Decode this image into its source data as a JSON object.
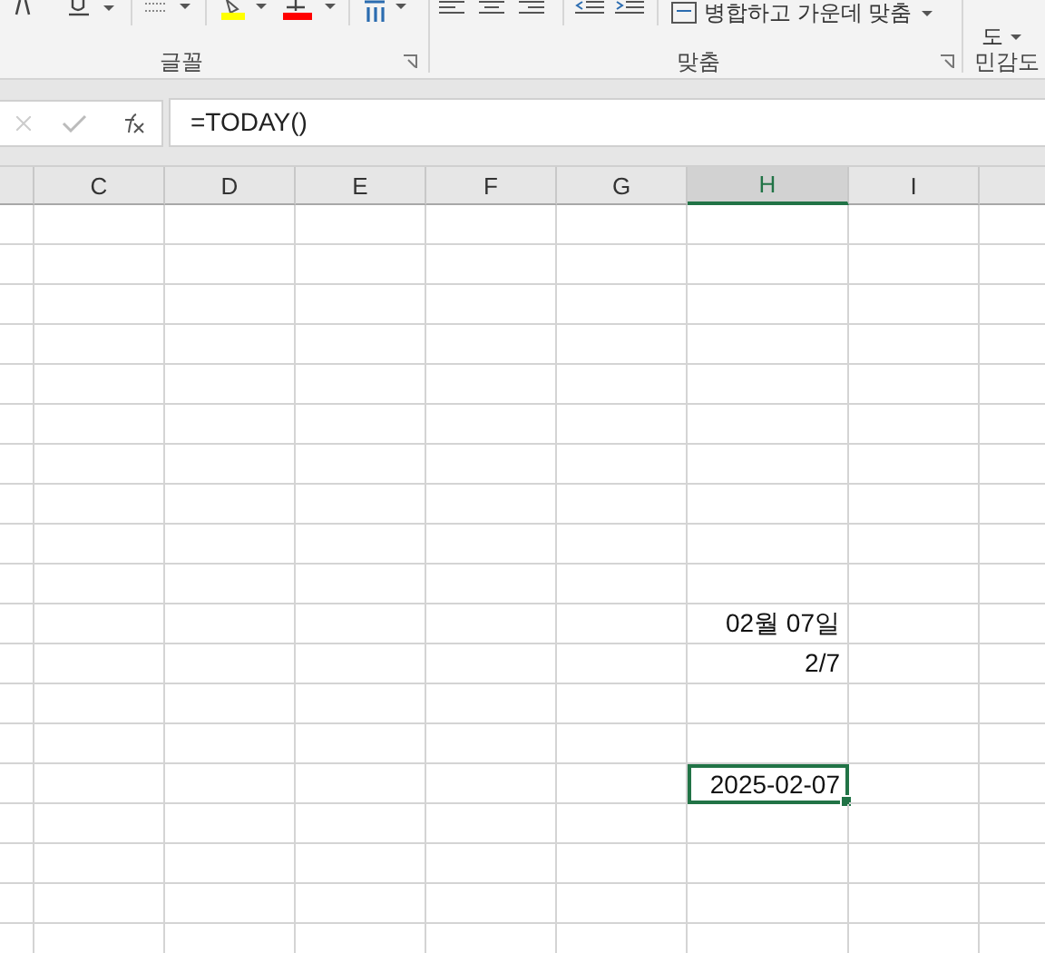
{
  "ribbon": {
    "merge_button": {
      "label": "병합하고 가운데 맞춤"
    },
    "sensitivity_button": {
      "label": "도"
    },
    "groups": [
      {
        "label": "글꼴"
      },
      {
        "label": "맞춤"
      },
      {
        "label": "민감도"
      }
    ]
  },
  "formula_bar": {
    "value": "=TODAY()"
  },
  "columns": [
    {
      "selected": false
    },
    {
      "label": "C",
      "selected": false
    },
    {
      "label": "D",
      "selected": false
    },
    {
      "label": "E",
      "selected": false
    },
    {
      "label": "F",
      "selected": false
    },
    {
      "label": "G",
      "selected": false
    },
    {
      "label": "H",
      "selected": true
    },
    {
      "label": "I",
      "selected": false
    },
    {
      "selected": false
    }
  ],
  "rows": [
    {
      "column_h": {
        "selected": false
      }
    },
    {
      "column_h": {
        "selected": false
      }
    },
    {
      "column_h": {
        "selected": false
      }
    },
    {
      "column_h": {
        "selected": false
      }
    },
    {
      "column_h": {
        "selected": false
      }
    },
    {
      "column_h": {
        "selected": false
      }
    },
    {
      "column_h": {
        "selected": false
      }
    },
    {
      "column_h": {
        "selected": false
      }
    },
    {
      "column_h": {
        "selected": false
      }
    },
    {
      "column_h": {
        "selected": false
      }
    },
    {
      "column_h": {
        "value": "02월 07일",
        "selected": false
      }
    },
    {
      "column_h": {
        "value": "2/7",
        "selected": false
      }
    },
    {
      "column_h": {
        "selected": false
      }
    },
    {
      "column_h": {
        "selected": false
      }
    },
    {
      "column_h": {
        "value": "2025-02-07",
        "selected": true
      }
    },
    {
      "column_h": {
        "selected": false
      }
    },
    {
      "column_h": {
        "selected": false
      }
    },
    {
      "column_h": {
        "selected": false
      }
    },
    {
      "column_h": {
        "selected": false
      }
    }
  ]
}
